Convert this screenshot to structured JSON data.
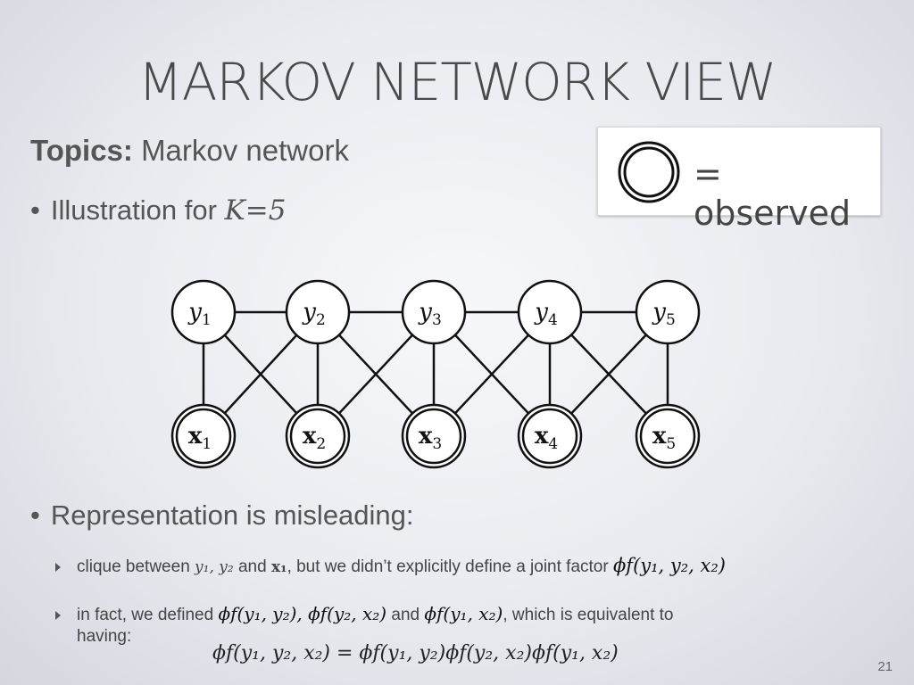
{
  "slide": {
    "title": "MARKOV NETWORK VIEW",
    "topics_label": "Topics:",
    "topics_value": "Markov network",
    "bullet1_text": "Illustration for",
    "bullet1_math": "K=5",
    "bullet2_text": "Representation is misleading:",
    "sub1_text_a": "clique between",
    "sub1_math_a": "y₁, y₂",
    "sub1_text_b": "and",
    "sub1_math_b": "x₁",
    "sub1_text_c": ", but we didn’t explicitly define a joint factor",
    "sub1_math_c": "ϕf(y₁, y₂, x₂)",
    "sub2_text_a": "in fact, we defined",
    "sub2_math_a": "ϕf(y₁, y₂), ϕf(y₂, x₂)",
    "sub2_text_b": "and",
    "sub2_math_b": "ϕf(y₁, x₂)",
    "sub2_text_c": ", which is equivalent to",
    "sub2_text_d": "having:",
    "equation": "ϕf(y₁, y₂, x₂) = ϕf(y₁, y₂)ϕf(y₂, x₂)ϕf(y₁, x₂)",
    "page_number": "21"
  },
  "legend": {
    "text": "= observed"
  },
  "diagram": {
    "nodes": [
      {
        "id": "y1",
        "label": "y",
        "sub": "1",
        "observed": false
      },
      {
        "id": "y2",
        "label": "y",
        "sub": "2",
        "observed": false
      },
      {
        "id": "y3",
        "label": "y",
        "sub": "3",
        "observed": false
      },
      {
        "id": "y4",
        "label": "y",
        "sub": "4",
        "observed": false
      },
      {
        "id": "y5",
        "label": "y",
        "sub": "5",
        "observed": false
      },
      {
        "id": "x1",
        "label": "x",
        "sub": "1",
        "observed": true
      },
      {
        "id": "x2",
        "label": "x",
        "sub": "2",
        "observed": true
      },
      {
        "id": "x3",
        "label": "x",
        "sub": "3",
        "observed": true
      },
      {
        "id": "x4",
        "label": "x",
        "sub": "4",
        "observed": true
      },
      {
        "id": "x5",
        "label": "x",
        "sub": "5",
        "observed": true
      }
    ],
    "edges": [
      [
        "y1",
        "y2"
      ],
      [
        "y2",
        "y3"
      ],
      [
        "y3",
        "y4"
      ],
      [
        "y4",
        "y5"
      ],
      [
        "y1",
        "x1"
      ],
      [
        "y1",
        "x2"
      ],
      [
        "y2",
        "x1"
      ],
      [
        "y2",
        "x2"
      ],
      [
        "y2",
        "x3"
      ],
      [
        "y3",
        "x2"
      ],
      [
        "y3",
        "x3"
      ],
      [
        "y3",
        "x4"
      ],
      [
        "y4",
        "x3"
      ],
      [
        "y4",
        "x4"
      ],
      [
        "y4",
        "x5"
      ],
      [
        "y5",
        "x4"
      ],
      [
        "y5",
        "x5"
      ]
    ]
  }
}
